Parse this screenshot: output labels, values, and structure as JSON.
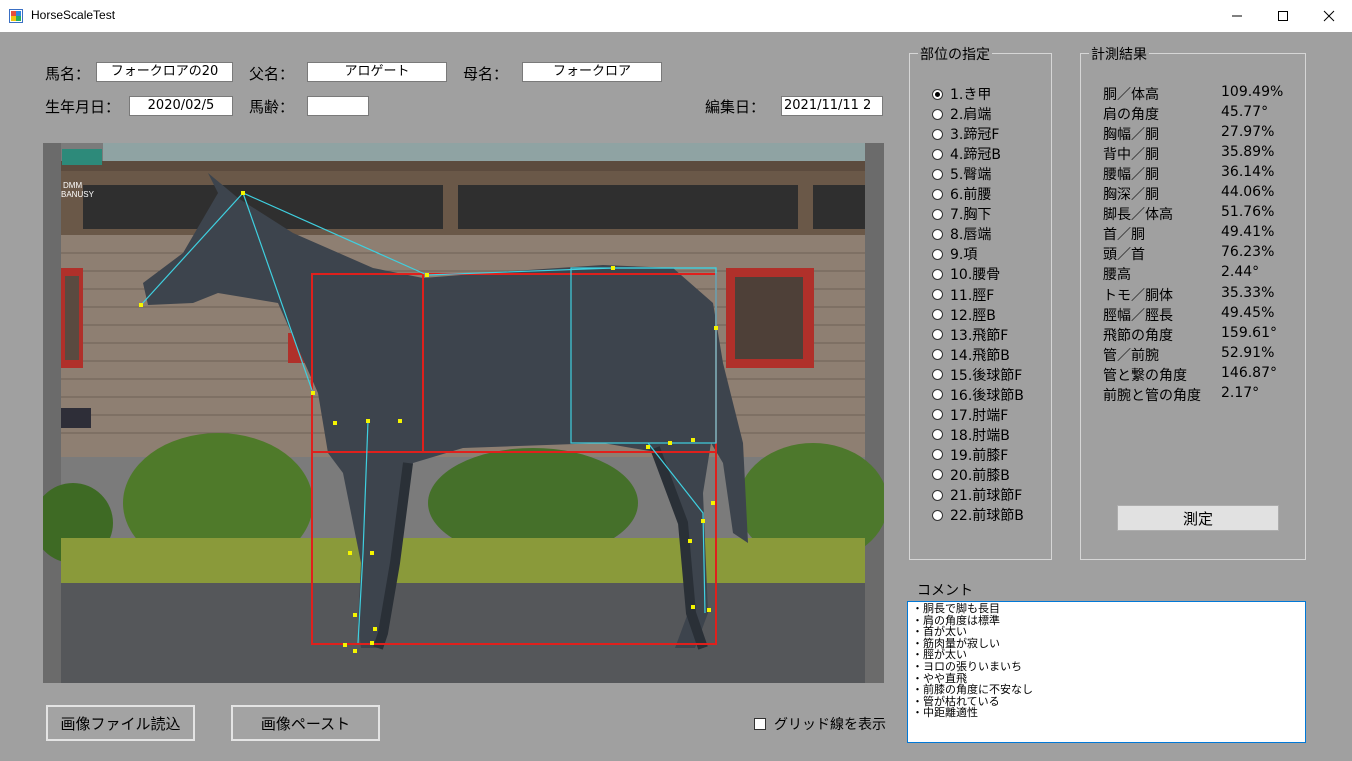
{
  "window": {
    "title": "HorseScaleTest"
  },
  "form": {
    "horse_name_label": "馬名：",
    "horse_name": "フォークロアの20",
    "sire_label": "父名：",
    "sire": "アロゲート",
    "dam_label": "母名：",
    "dam": "フォークロア",
    "birthdate_label": "生年月日：",
    "birthdate": "2020/02/5",
    "age_label": "馬齢：",
    "age": "",
    "edit_date_label": "編集日：",
    "edit_date": "2021/11/11 2"
  },
  "image": {
    "watermark": "DMM BANUSY"
  },
  "parts": {
    "title": "部位の指定",
    "selected_index": 0,
    "items": [
      "1.き甲",
      "2.肩端",
      "3.蹄冠F",
      "4.蹄冠B",
      "5.臀端",
      "6.前腰",
      "7.胸下",
      "8.唇端",
      "9.項",
      "10.腰骨",
      "11.脛F",
      "12.脛B",
      "13.飛節F",
      "14.飛節B",
      "15.後球節F",
      "16.後球節B",
      "17.肘端F",
      "18.肘端B",
      "19.前膝F",
      "20.前膝B",
      "21.前球節F",
      "22.前球節B"
    ]
  },
  "results": {
    "title": "計測結果",
    "rows": [
      {
        "label": "胴／体高",
        "value": "109.49%"
      },
      {
        "label": "肩の角度",
        "value": "45.77°"
      },
      {
        "label": "胸幅／胴",
        "value": "27.97%"
      },
      {
        "label": "背中／胴",
        "value": "35.89%"
      },
      {
        "label": "腰幅／胴",
        "value": "36.14%"
      },
      {
        "label": "胸深／胴",
        "value": "44.06%"
      },
      {
        "label": "脚長／体高",
        "value": "51.76%"
      },
      {
        "label": "首／胴",
        "value": "49.41%"
      },
      {
        "label": "頭／首",
        "value": "76.23%"
      },
      {
        "label": "腰高",
        "value": "2.44°"
      },
      {
        "label": "トモ／胴体",
        "value": "35.33%"
      },
      {
        "label": "脛幅／脛長",
        "value": "49.45%"
      },
      {
        "label": "飛節の角度",
        "value": "159.61°"
      },
      {
        "label": "管／前腕",
        "value": "52.91%"
      },
      {
        "label": "管と繋の角度",
        "value": "146.87°"
      },
      {
        "label": "前腕と管の角度",
        "value": "2.17°"
      }
    ],
    "measure_button": "測定"
  },
  "comment": {
    "label": "コメント",
    "lines": [
      "・胴長で脚も長目",
      "・肩の角度は標準",
      "・首が太い",
      "・筋肉量が寂しい",
      "・脛が太い",
      "・ヨロの張りいまいち",
      "・やや直飛",
      "・前膝の角度に不安なし",
      "・管が枯れている",
      "・中距離適性"
    ]
  },
  "buttons": {
    "load_image": "画像ファイル読込",
    "paste_image": "画像ペースト"
  },
  "grid_toggle": {
    "label": "グリッド線を表示",
    "checked": false
  },
  "colors": {
    "background": "#a0a0a0",
    "overlay_red": "#e0201c",
    "overlay_cyan": "#3fd0e0",
    "marker": "#f5f500"
  }
}
